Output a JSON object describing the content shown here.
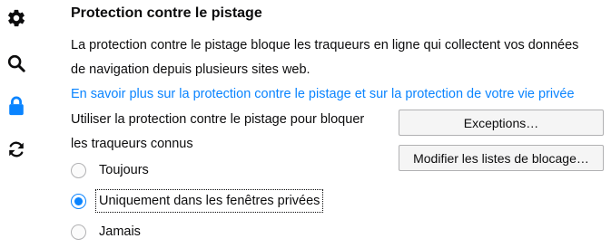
{
  "sidebar": {
    "items": [
      {
        "icon": "gear-icon",
        "active": false
      },
      {
        "icon": "search-icon",
        "active": false
      },
      {
        "icon": "lock-icon",
        "active": true
      },
      {
        "icon": "sync-icon",
        "active": false
      }
    ],
    "colors": {
      "default": "#0c0c0d",
      "active": "#0a84ff"
    }
  },
  "section": {
    "title": "Protection contre le pistage",
    "description_line1": "La protection contre le pistage bloque les traqueurs en ligne qui collectent vos données",
    "description_line2": "de navigation depuis plusieurs sites web.",
    "learn_more_link": "En savoir plus sur la protection contre le pistage et sur la protection de votre vie privée",
    "use_label_line1": "Utiliser la protection contre le pistage pour bloquer",
    "use_label_line2": "les traqueurs connus"
  },
  "buttons": {
    "exceptions": "Exceptions…",
    "modify_blocklists": "Modifier les listes de blocage…"
  },
  "radio_options": [
    {
      "label": "Toujours",
      "checked": false
    },
    {
      "label": "Uniquement dans les fenêtres privées",
      "checked": true
    },
    {
      "label": "Jamais",
      "checked": false
    }
  ],
  "colors": {
    "accent": "#0a84ff",
    "text": "#0c0c0d",
    "button_bg": "#f5f5f5",
    "button_border": "#b1b1b3"
  }
}
